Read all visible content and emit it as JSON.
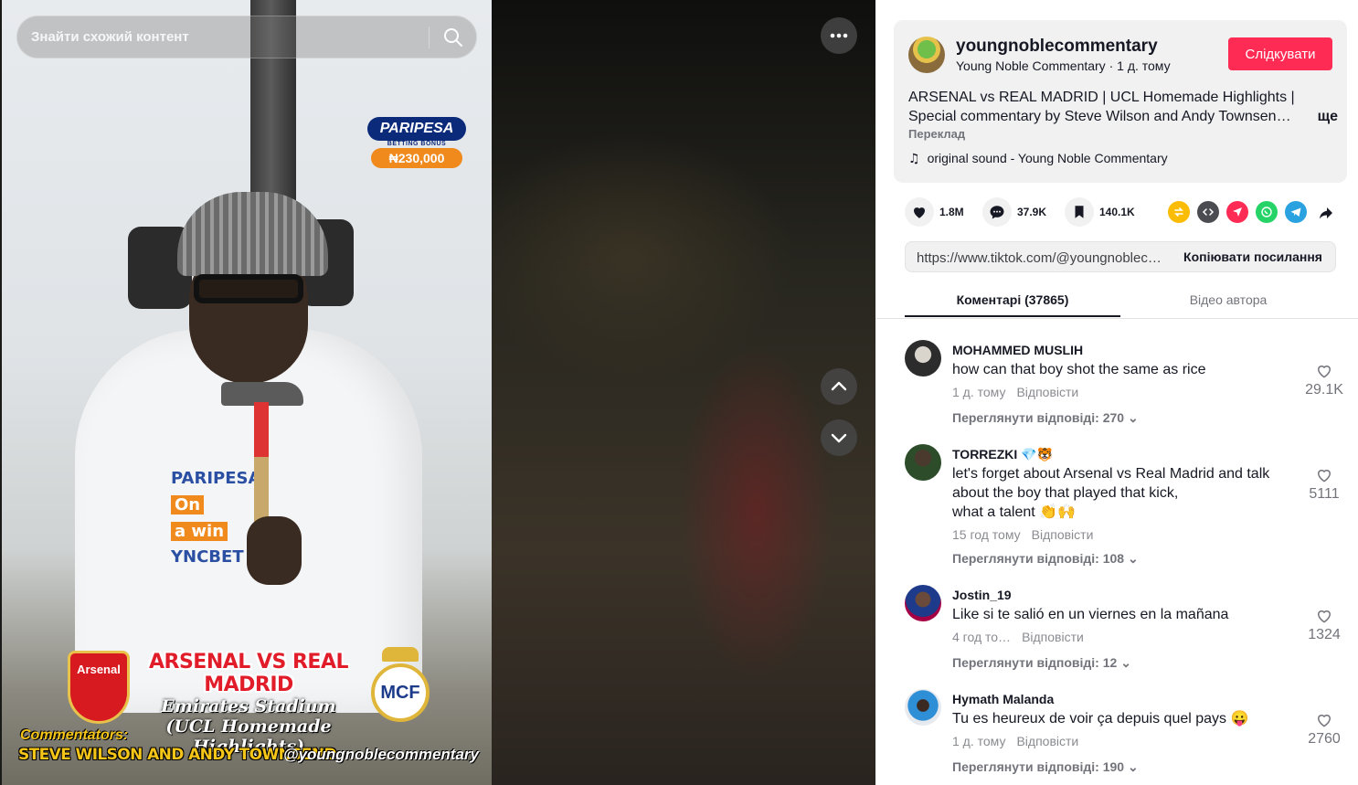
{
  "search": {
    "placeholder": "Знайти схожий контент"
  },
  "video_overlay": {
    "sponsor_name": "PARIPESA",
    "sponsor_tag": "BETTING BONUS",
    "sponsor_amount": "₦230,000",
    "hoodie_print_brand": "PARIPESA",
    "hoodie_print_line1": "On",
    "hoodie_print_line2": "a win",
    "hoodie_print_code": "YNCBET",
    "match_title": "ARSENAL VS REAL MADRID",
    "venue": "Emirates Stadium",
    "subtitle": "(UCL Homemade Highlights)",
    "home_badge": "Arsenal",
    "away_badge_monogram": "MCF",
    "commentators_label": "Commentators:",
    "commentators_names": "STEVE WILSON AND ANDY TOWNSEND",
    "handle": "@youngnoblecommentary"
  },
  "post": {
    "username": "youngnoblecommentary",
    "display_name": "Young Noble Commentary",
    "separator": "·",
    "time": "1 д. тому",
    "follow_label": "Слідкувати",
    "description": "ARSENAL vs REAL MADRID | UCL Homemade Highlights | Special commentary by Steve Wilson and Andy Townsen…",
    "more_label": "ще",
    "translate_label": "Переклад",
    "sound_icon": "music-note-icon",
    "sound": "original sound - Young Noble Commentary"
  },
  "actions": {
    "likes": "1.8M",
    "comments": "37.9K",
    "saves": "140.1K",
    "share_targets": [
      "repost-icon",
      "embed-icon",
      "send-icon",
      "whatsapp-icon",
      "telegram-icon",
      "share-arrow-icon"
    ]
  },
  "copy_link": {
    "url": "https://www.tiktok.com/@youngnobleco…",
    "button_label": "Копіювати посилання"
  },
  "tabs": [
    {
      "label": "Коментарі (37865)",
      "active": true
    },
    {
      "label": "Відео автора",
      "active": false
    }
  ],
  "colors": {
    "accent": "#fe2c55",
    "text": "#161823",
    "muted": "#73747b"
  },
  "comments": [
    {
      "author": "MOHAMMED MUSLIH",
      "text": "how can that boy shot the same as rice",
      "time": "1 д. тому",
      "reply_label": "Відповісти",
      "view_replies": "Переглянути відповіді: 270",
      "likes": "29.1K"
    },
    {
      "author": "TORREZKI",
      "author_emojis": "💎🐯",
      "text": "let's forget about Arsenal vs Real Madrid and talk about the boy that played that kick,",
      "text2": "what a talent",
      "text2_emojis": "👏🙌",
      "time": "15 год тому",
      "reply_label": "Відповісти",
      "view_replies": "Переглянути відповіді: 108",
      "likes": "5111"
    },
    {
      "author": "Jostin_19",
      "text": "Like si te salió en un viernes en la mañana",
      "time": "4 год то…",
      "reply_label": "Відповісти",
      "view_replies": "Переглянути відповіді: 12",
      "likes": "1324"
    },
    {
      "author": "Hymath Malanda",
      "text": "Tu es heureux de voir ça depuis quel pays",
      "text_emoji": "😛",
      "time": "1 д. тому",
      "reply_label": "Відповісти",
      "view_replies": "Переглянути відповіді: 190",
      "likes": "2760"
    }
  ]
}
